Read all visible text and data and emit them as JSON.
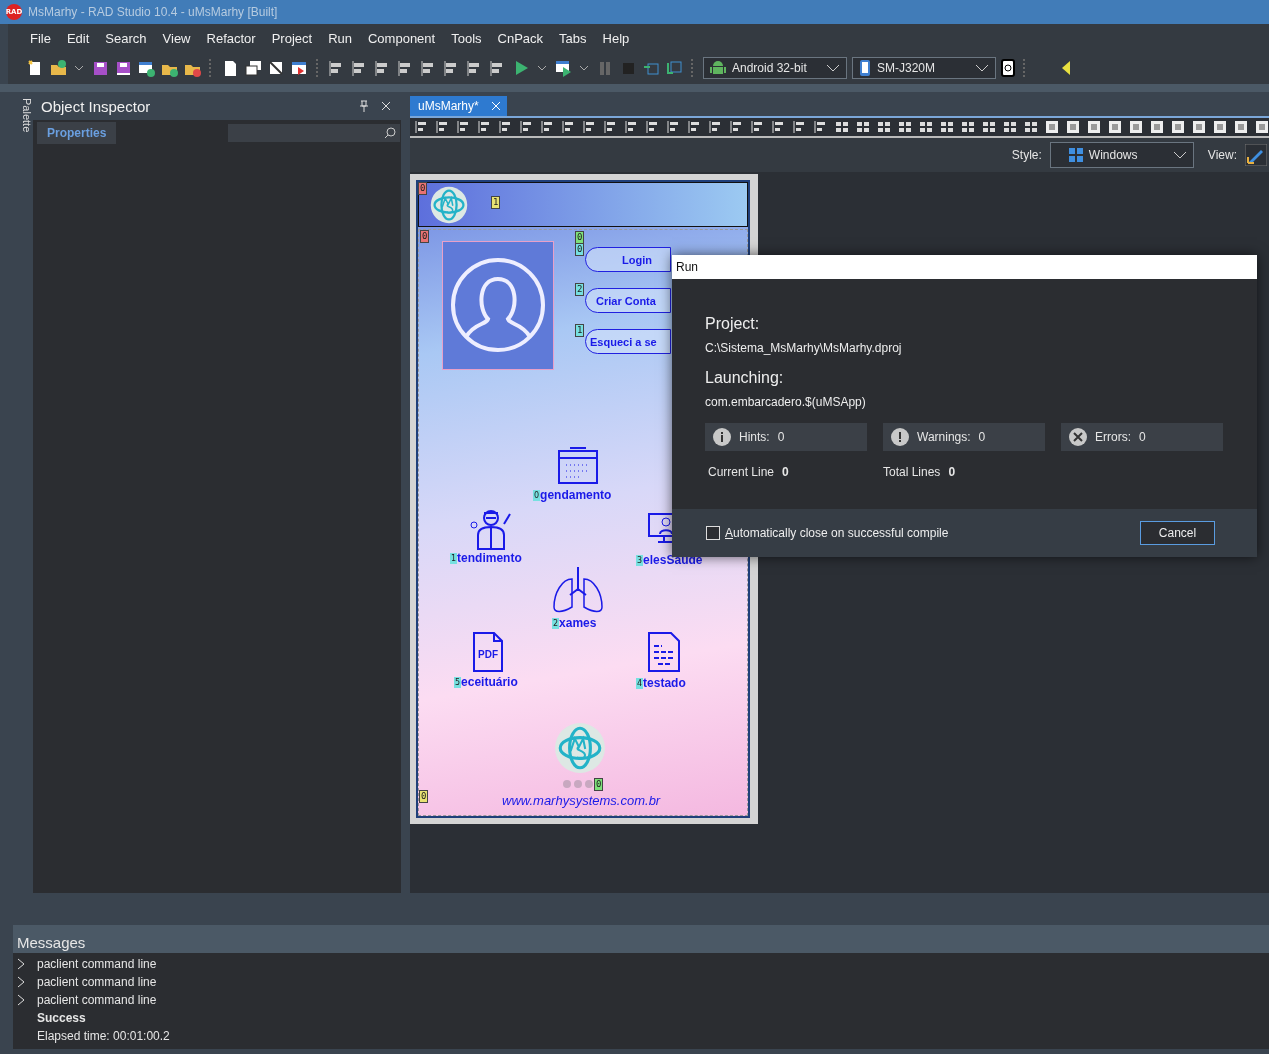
{
  "window": {
    "badge": "RAD",
    "title": "MsMarhy - RAD Studio 10.4 - uMsMarhy [Built]"
  },
  "menu": [
    "File",
    "Edit",
    "Search",
    "View",
    "Refactor",
    "Project",
    "Run",
    "Component",
    "Tools",
    "CnPack",
    "Tabs",
    "Help"
  ],
  "toolbar": {
    "platform": "Android 32-bit",
    "device": "SM-J320M"
  },
  "palette_tab": "Palette",
  "object_inspector": {
    "title": "Object Inspector",
    "tabs": [
      {
        "label": "Properties",
        "selected": true
      }
    ]
  },
  "editor_tabs": [
    {
      "label": "uMsMarhy*",
      "selected": true
    }
  ],
  "designer": {
    "style_label": "Style:",
    "style_value": "Windows",
    "view_label": "View:",
    "form": {
      "header_markers": [
        {
          "text": "0",
          "color": "#e87272"
        },
        {
          "text": "1",
          "color": "#e8e272"
        }
      ],
      "body_marker": {
        "text": "0",
        "color": "#e87272"
      },
      "buttons_marker": {
        "text": "0",
        "color": "#7ee07a"
      },
      "buttons": [
        {
          "label": "Login",
          "marker": "0"
        },
        {
          "label": "Criar Conta",
          "marker": "2"
        },
        {
          "label": "Esqueci a se",
          "marker": "1"
        }
      ],
      "tiles": [
        {
          "kind": "calendar",
          "badge": "0",
          "label": "gendamento"
        },
        {
          "kind": "doctor",
          "badge": "1",
          "label": "tendimento"
        },
        {
          "kind": "monitor",
          "badge": "3",
          "label": "elesSaude"
        },
        {
          "kind": "lungs",
          "badge": "2",
          "label": "xames"
        },
        {
          "kind": "pdf",
          "badge": "5",
          "label": "eceituário",
          "icon_text": "PDF"
        },
        {
          "kind": "document",
          "badge": "4",
          "label": "testado"
        }
      ],
      "loader_marker": {
        "text": "0",
        "color": "#7ee07a"
      },
      "footer_marker": {
        "text": "0",
        "color": "#e8e272"
      },
      "url": "www.marhysystems.com.br"
    }
  },
  "run_dialog": {
    "title": "Run",
    "project_label": "Project:",
    "project_path": "C:\\Sistema_MsMarhy\\MsMarhy.dproj",
    "launching_label": "Launching:",
    "launching_value": "com.embarcadero.$(uMSApp)",
    "counters": [
      {
        "kind": "info",
        "label": "Hints:",
        "value": "0"
      },
      {
        "kind": "warning",
        "label": "Warnings:",
        "value": "0"
      },
      {
        "kind": "error",
        "label": "Errors:",
        "value": "0"
      }
    ],
    "current_line": {
      "label": "Current Line",
      "value": "0"
    },
    "total_lines": {
      "label": "Total Lines",
      "value": "0"
    },
    "auto_close": {
      "label": "Automatically close on successful compile",
      "checked": false
    },
    "cancel": "Cancel"
  },
  "messages": {
    "title": "Messages",
    "lines": [
      {
        "kind": "expandable",
        "text": "paclient command line"
      },
      {
        "kind": "expandable",
        "text": "paclient command line"
      },
      {
        "kind": "expandable",
        "text": "paclient command line"
      },
      {
        "kind": "result",
        "text": "Success"
      },
      {
        "kind": "plain",
        "text": "Elapsed time: 00:01:00.2"
      }
    ]
  }
}
